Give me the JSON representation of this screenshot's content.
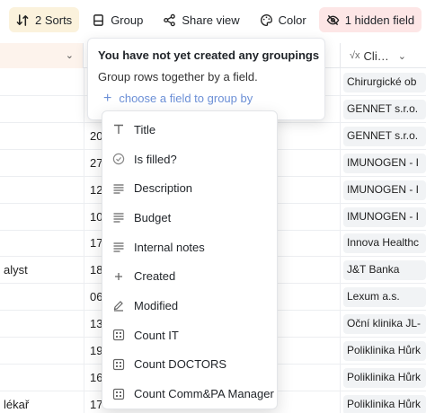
{
  "toolbar": {
    "sorts_label": "2 Sorts",
    "group_label": "Group",
    "share_label": "Share view",
    "color_label": "Color",
    "hidden_label": "1 hidden field"
  },
  "columns": {
    "right_header": "Cli…",
    "right_header_icon": "formula-icon"
  },
  "rows": [
    {
      "a": "",
      "b": "",
      "c": "Chirurgické ob"
    },
    {
      "a": "",
      "b": "",
      "c": "GENNET s.r.o."
    },
    {
      "a": "",
      "b": "20",
      "c": "GENNET s.r.o."
    },
    {
      "a": "",
      "b": "27",
      "c": "IMUNOGEN - I"
    },
    {
      "a": "",
      "b": "12",
      "c": "IMUNOGEN - I"
    },
    {
      "a": "",
      "b": "10",
      "c": "IMUNOGEN - I"
    },
    {
      "a": "",
      "b": "17",
      "c": "Innova Healthc"
    },
    {
      "a": "alyst",
      "b": "18",
      "c": "J&T Banka"
    },
    {
      "a": "",
      "b": "06",
      "c": "Lexum a.s."
    },
    {
      "a": "",
      "b": "13",
      "c": "Oční klinika JL-"
    },
    {
      "a": "",
      "b": "19",
      "c": "Poliklinika Hůrk"
    },
    {
      "a": "",
      "b": "16",
      "c": "Poliklinika Hůrk"
    },
    {
      "a": "lékař",
      "b": "17",
      "c": "Poliklinika Hůrk"
    }
  ],
  "group_popover": {
    "title": "You have not yet created any groupings",
    "subtitle": "Group rows together by a field.",
    "link": "choose a field to group by"
  },
  "field_menu": [
    {
      "label": "Title",
      "icon": "text-type-icon"
    },
    {
      "label": "Is filled?",
      "icon": "check-circle-icon"
    },
    {
      "label": "Description",
      "icon": "long-text-icon"
    },
    {
      "label": "Budget",
      "icon": "long-text-icon"
    },
    {
      "label": "Internal notes",
      "icon": "long-text-icon"
    },
    {
      "label": "Created",
      "icon": "plus-icon"
    },
    {
      "label": "Modified",
      "icon": "edit-icon"
    },
    {
      "label": "Count IT",
      "icon": "count-icon"
    },
    {
      "label": "Count DOCTORS",
      "icon": "count-icon"
    },
    {
      "label": "Count Comm&PA Manager",
      "icon": "count-icon"
    }
  ]
}
